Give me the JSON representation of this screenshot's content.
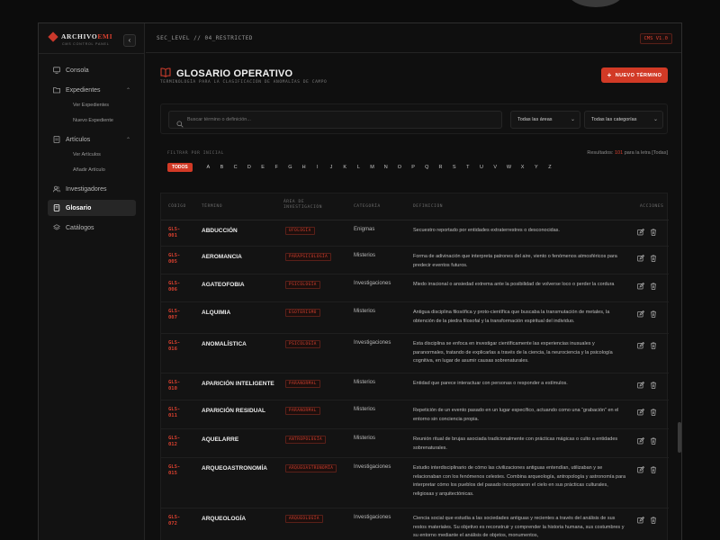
{
  "app": {
    "logo_main": "ARCHIVO",
    "logo_accent": "EMI",
    "logo_sub": "CMS CONTROL PANEL",
    "sec_level": "SEC_LEVEL // 04_RESTRICTED",
    "cms_version": "CMS V1.0"
  },
  "sidebar": {
    "items": [
      {
        "label": "Consola",
        "icon": "monitor-icon"
      },
      {
        "label": "Expedientes",
        "icon": "folder-icon",
        "children": [
          "Ver Expedientes",
          "Nuevo Expediente"
        ]
      },
      {
        "label": "Artículos",
        "icon": "document-icon",
        "children": [
          "Ver Artículos",
          "Añadir Artículo"
        ]
      },
      {
        "label": "Investigadores",
        "icon": "users-icon"
      },
      {
        "label": "Glosario",
        "icon": "book-icon",
        "active": true
      },
      {
        "label": "Catálogos",
        "icon": "layers-icon"
      }
    ]
  },
  "page": {
    "title": "GLOSARIO OPERATIVO",
    "subtitle": "TERMINOLOGÍA PARA LA CLASIFICACIÓN DE ANOMALÍAS DE CAMPO",
    "new_button": "NUEVO TÉRMINO"
  },
  "search": {
    "placeholder": "Buscar término o definición...",
    "area_select": "Todas las áreas",
    "category_select": "Todas las categorías"
  },
  "filter": {
    "label": "FILTRAR POR INICIAL",
    "results_prefix": "Resultados:",
    "results_count": "101",
    "results_suffix": "para la letra [Todas]",
    "all_label": "TODOS",
    "letters": [
      "A",
      "B",
      "C",
      "D",
      "E",
      "F",
      "G",
      "H",
      "I",
      "J",
      "K",
      "L",
      "M",
      "N",
      "O",
      "P",
      "Q",
      "R",
      "S",
      "T",
      "U",
      "V",
      "W",
      "X",
      "Y",
      "Z"
    ]
  },
  "table": {
    "headers": {
      "code": "CÓDIGO",
      "term": "TÉRMINO",
      "area": "ÁREA DE INVESTIGACIÓN",
      "category": "CATEGORÍA",
      "definition": "DEFINICIÓN",
      "actions": "ACCIONES"
    },
    "rows": [
      {
        "code": "GLS-001",
        "term": "ABDUCCIÓN",
        "area": "UFOLOGÍA",
        "category": "Enigmas",
        "definition": "Secuestro reportado por entidades extraterrestres o desconocidas."
      },
      {
        "code": "GLS-005",
        "term": "AEROMANCIA",
        "area": "PARAPSICOLOGÍA",
        "category": "Misterios",
        "definition": "Forma de adivinación que interpreta patrones del aire, viento o fenómenos atmosféricos para predecir eventos futuros."
      },
      {
        "code": "GLS-006",
        "term": "AGATEOFOBIA",
        "area": "PSICOLOGÍA",
        "category": "Investigaciones",
        "definition": "Miedo irracional o ansiedad extrema ante la posibilidad de volverse loco o perder la cordura"
      },
      {
        "code": "GLS-007",
        "term": "ALQUIMIA",
        "area": "ESOTERISMO",
        "category": "Misterios",
        "definition": "Antigua disciplina filosófica y proto-científica que buscaba la transmutación de metales, la obtención de la piedra filosofal y la transformación espiritual del individuo."
      },
      {
        "code": "GLS-016",
        "term": "ANOMALÍSTICA",
        "area": "PSICOLOGÍA",
        "category": "Investigaciones",
        "definition": "Esta disciplina se enfoca en investigar científicamente las experiencias inusuales y paranormales, tratando de explicarlas a través de la ciencia, la neurociencia y la psicología cognitiva, en lugar de asumir causas sobrenaturales."
      },
      {
        "code": "GLS-010",
        "term": "APARICIÓN INTELIGENTE",
        "area": "PARANORMAL",
        "category": "Misterios",
        "definition": "Entidad que parece interactuar con personas o responder a estímulos."
      },
      {
        "code": "GLS-011",
        "term": "APARICIÓN RESIDUAL",
        "area": "PARANORMAL",
        "category": "Misterios",
        "definition": "Repetición de un evento pasado en un lugar específico, actuando como una “grabación” en el entorno sin conciencia propia."
      },
      {
        "code": "GLS-012",
        "term": "AQUELARRE",
        "area": "ANTROPOLOGÍA",
        "category": "Misterios",
        "definition": "Reunión ritual de brujas asociada tradicionalmente con prácticas mágicas o culto a entidades sobrenaturales."
      },
      {
        "code": "GLS-015",
        "term": "ARQUEOASTRONOMÍA",
        "area": "ARQUEOASTRONOMÍA",
        "category": "Investigaciones",
        "definition": "Estudio interdisciplinario de cómo las civilizaciones antiguas entendían, utilizaban y se relacionaban con los fenómenos celestes. Combina arqueología, antropología y astronomía para interpretar cómo los pueblos del pasado incorporaron el cielo en sus prácticas culturales, religiosas y arquitectónicas."
      },
      {
        "code": "GLS-072",
        "term": "ARQUEOLOGÍA",
        "area": "ARQUEOLOGÍA",
        "category": "Investigaciones",
        "definition": "Ciencia social que estudia a las sociedades antiguas y recientes a través del análisis de sus restos materiales. Su objetivo es reconstruir y comprender la historia humana, sus costumbres y su entorno mediante el análisis de objetos, monumentos,"
      }
    ]
  },
  "colors": {
    "accent": "#d23a26",
    "background": "#0f0f0f"
  }
}
